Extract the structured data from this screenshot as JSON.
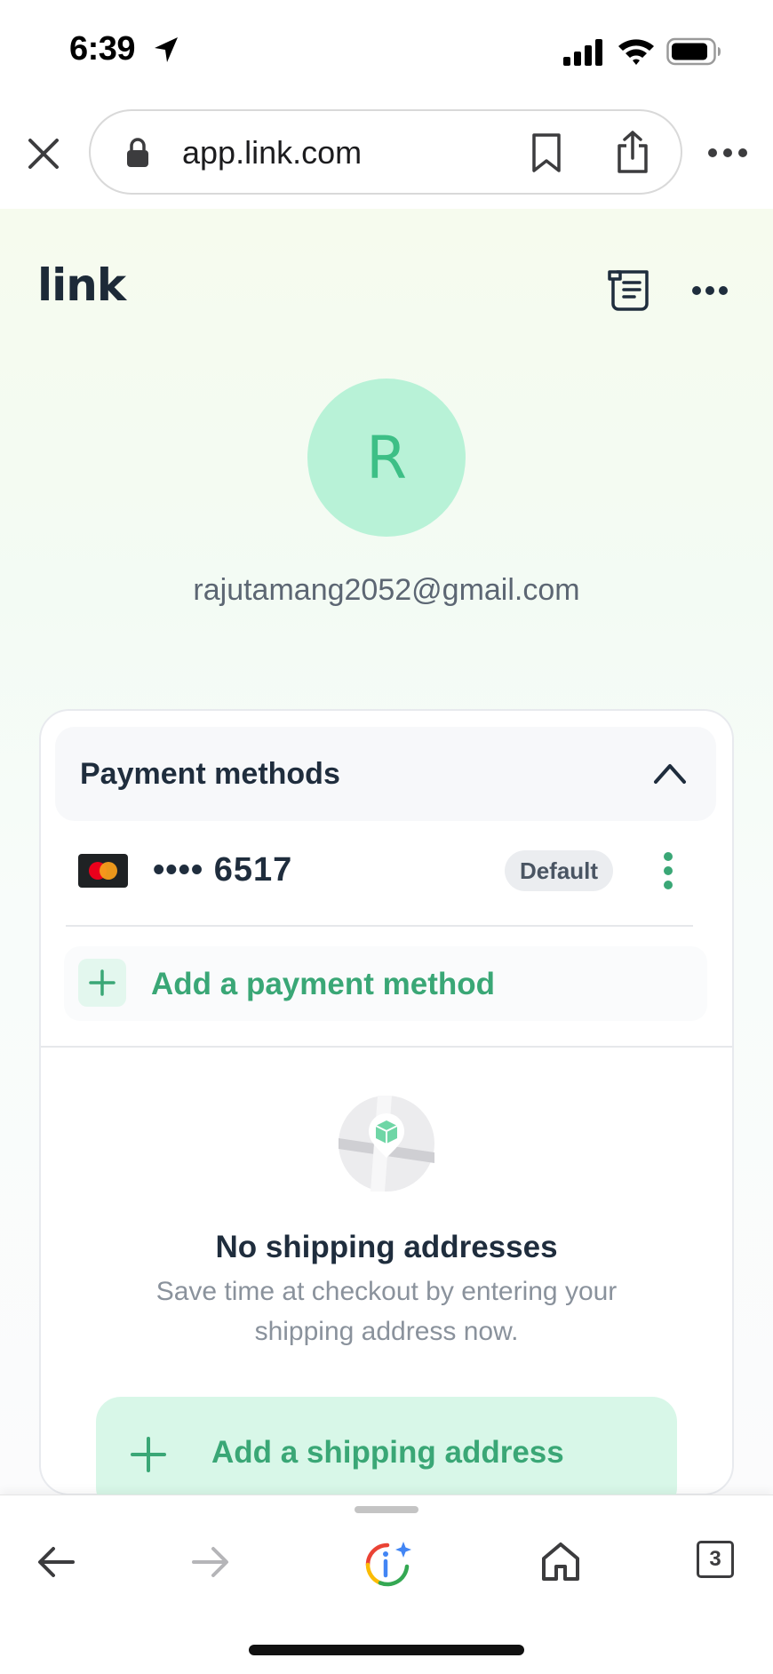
{
  "status_bar": {
    "time": "6:39"
  },
  "browser": {
    "url": "app.link.com"
  },
  "app": {
    "logo": "link"
  },
  "profile": {
    "avatar_initial": "R",
    "email": "rajutamang2052@gmail.com"
  },
  "payment_methods": {
    "title": "Payment methods",
    "cards": [
      {
        "brand": "mastercard",
        "masked_number": "•••• 6517",
        "badge": "Default"
      }
    ],
    "add_label": "Add a payment method"
  },
  "shipping": {
    "empty_title": "No shipping addresses",
    "empty_desc": "Save time at checkout by entering your shipping address now.",
    "add_label": "Add a shipping address"
  },
  "toolbar": {
    "tab_count": "3"
  },
  "colors": {
    "accent_green": "#3aa776",
    "avatar_bg": "#b8f2d7",
    "text_dark": "#1f2d3d"
  }
}
